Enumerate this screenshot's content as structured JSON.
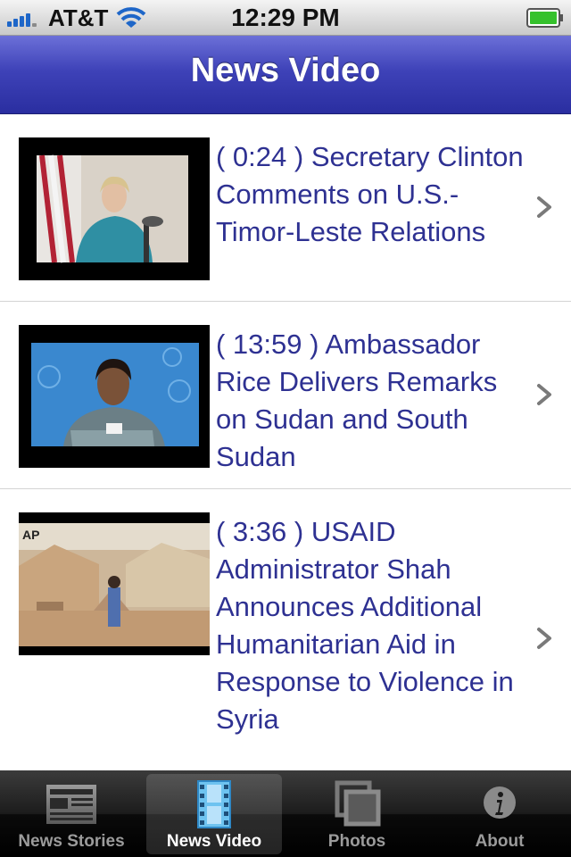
{
  "status_bar": {
    "carrier": "AT&T",
    "time": "12:29 PM",
    "battery_color": "#35c12c"
  },
  "header": {
    "title": "News Video"
  },
  "videos": [
    {
      "title": "( 0:24 ) Secretary Clinton Comments on U.S.-Timor-Leste Relations"
    },
    {
      "title": "( 13:59 ) Ambassador Rice Delivers Remarks on Sudan and South Sudan"
    },
    {
      "title": "( 3:36 ) USAID Administrator Shah Announces Additional Humanitarian Aid in Response to Violence in Syria"
    }
  ],
  "thumbnails": [
    {
      "icon": "flag-speaker-thumbnail",
      "watermark": ""
    },
    {
      "icon": "un-podium-thumbnail",
      "watermark": ""
    },
    {
      "icon": "refugee-camp-thumbnail",
      "watermark": "AP"
    }
  ],
  "tab_bar": {
    "selected": "News Video",
    "tabs": [
      {
        "label": "News Stories",
        "icon": "newspaper-icon"
      },
      {
        "label": "News Video",
        "icon": "film-strip-icon"
      },
      {
        "label": "Photos",
        "icon": "photos-icon"
      },
      {
        "label": "About",
        "icon": "info-icon"
      }
    ]
  },
  "colors": {
    "accent": "#2e3192",
    "nav_bar": "#3e42b8",
    "tab_selected_icon": "#6ec3f0"
  }
}
